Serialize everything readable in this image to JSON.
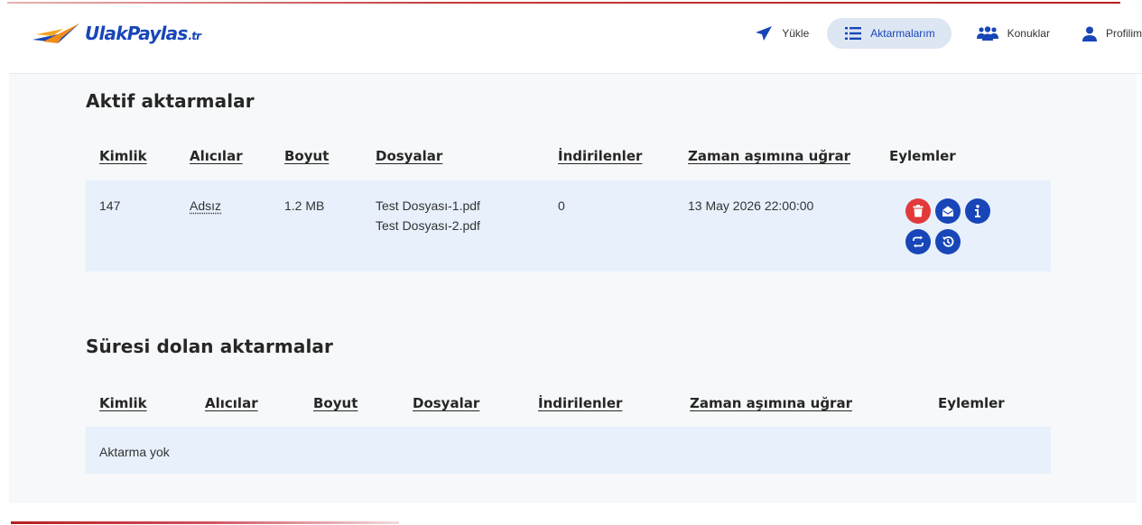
{
  "brand": {
    "name": "UlakPaylas",
    "tld": ".tr"
  },
  "nav": {
    "upload": "Yükle",
    "transfers": "Aktarmalarım",
    "guests": "Konuklar",
    "profile": "Profilim"
  },
  "colors": {
    "brand_blue": "#1846b8",
    "danger_red": "#e23a3a",
    "row_bg": "#e7f0fb",
    "active_nav_bg": "#dde6f3"
  },
  "active": {
    "title": "Aktif aktarmalar",
    "headers": {
      "id": "Kimlik",
      "recipients": "Alıcılar",
      "size": "Boyut",
      "files": "Dosyalar",
      "downloads": "İndirilenler",
      "expires": "Zaman aşımına uğrar",
      "actions": "Eylemler"
    },
    "rows": [
      {
        "id": "147",
        "recipients": "Adsız",
        "size": "1.2 MB",
        "files": [
          "Test Dosyası-1.pdf",
          "Test Dosyası-2.pdf"
        ],
        "downloads": "0",
        "expires": "13 May 2026 22:00:00",
        "actions": [
          "trash-icon",
          "envelope-open-icon",
          "info-icon",
          "repeat-icon",
          "history-icon"
        ]
      }
    ]
  },
  "expired": {
    "title": "Süresi dolan aktarmalar",
    "headers": {
      "id": "Kimlik",
      "recipients": "Alıcılar",
      "size": "Boyut",
      "files": "Dosyalar",
      "downloads": "İndirilenler",
      "expires": "Zaman aşımına uğrar",
      "actions": "Eylemler"
    },
    "empty_text": "Aktarma yok"
  }
}
